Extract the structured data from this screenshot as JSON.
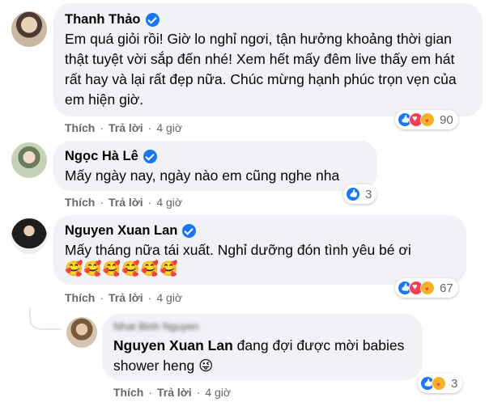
{
  "actions": {
    "like": "Thích",
    "reply": "Trả lời",
    "sep": "·"
  },
  "comments": [
    {
      "author": "Thanh Thảo",
      "text": "Em quá giỏi rồi! Giờ lo nghỉ ngơi, tận hưởng khoảng thời gian thật tuyệt vời sắp đến nhé! Xem hết mấy đêm live thấy em hát rất hay và lại rất đẹp nữa. Chúc mừng hạnh phúc trọn vẹn của em hiện giờ.",
      "time": "4 giờ",
      "reactions": [
        "like",
        "love",
        "care"
      ],
      "reaction_count": "90"
    },
    {
      "author": "Ngọc Hà Lê",
      "text": "Mấy ngày nay, ngày nào em cũng nghe nha",
      "time": "4 giờ",
      "reactions": [
        "like"
      ],
      "reaction_count": "3"
    },
    {
      "author": "Nguyen Xuan Lan",
      "text": "Mấy tháng nữa tái xuất. Nghỉ dưỡng đón tình yêu bé ơi",
      "emojis": "🥰🥰🥰🥰🥰🥰",
      "time": "4 giờ",
      "reactions": [
        "like",
        "love",
        "care"
      ],
      "reaction_count": "67"
    }
  ],
  "reply": {
    "author": "Nhat Binh Nguyen",
    "tag": "Nguyen Xuan Lan",
    "text": "đang đợi được mời babies shower heng",
    "emoji": "😜",
    "time": "4 giờ",
    "reactions": [
      "like",
      "care"
    ],
    "reaction_count": "3"
  }
}
